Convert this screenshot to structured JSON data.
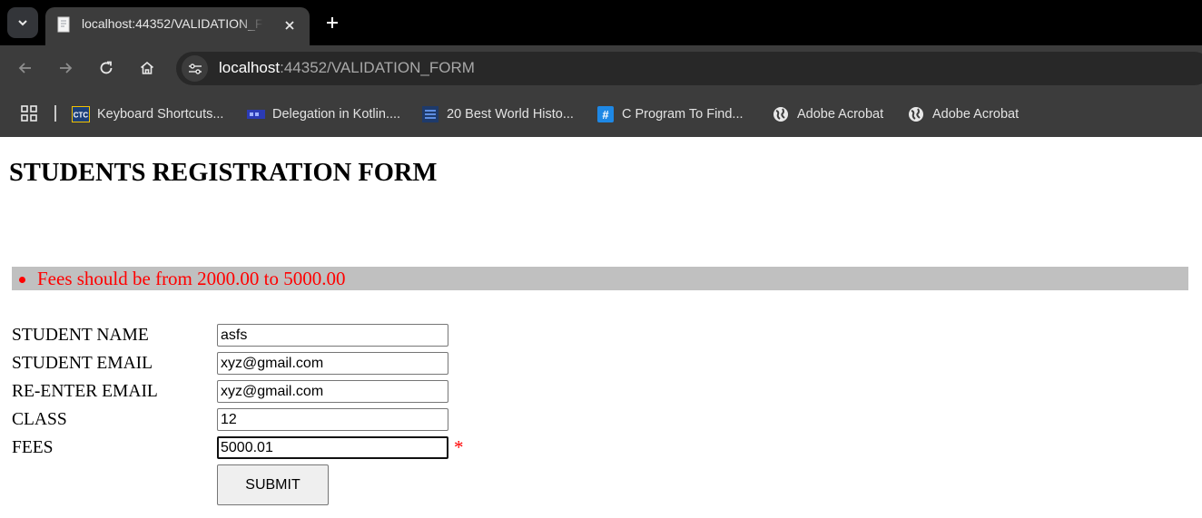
{
  "browser": {
    "tab": {
      "title": "localhost:44352/VALIDATION_FORM"
    },
    "address": {
      "host": "localhost",
      "rest": ":44352/VALIDATION_FORM"
    },
    "bookmarks": [
      {
        "label": "Keyboard Shortcuts...",
        "icon": "ctc-icon"
      },
      {
        "label": "Delegation in Kotlin....",
        "icon": "site-icon"
      },
      {
        "label": "20 Best World Histo...",
        "icon": "list-icon"
      },
      {
        "label": "C Program To Find...",
        "icon": "hash-icon"
      },
      {
        "label": "Adobe Acrobat",
        "icon": "globe-icon"
      },
      {
        "label": "Adobe Acrobat",
        "icon": "globe-icon"
      }
    ]
  },
  "page": {
    "title": "STUDENTS REGISTRATION FORM",
    "validation_summary": [
      "Fees should be from 2000.00 to 5000.00"
    ],
    "form": {
      "fields": [
        {
          "label": "STUDENT NAME",
          "value": "asfs"
        },
        {
          "label": "STUDENT EMAIL",
          "value": "xyz@gmail.com"
        },
        {
          "label": "RE-ENTER EMAIL",
          "value": "xyz@gmail.com"
        },
        {
          "label": "CLASS",
          "value": "12"
        },
        {
          "label": "FEES",
          "value": "5000.01"
        }
      ],
      "fees_error_marker": "*",
      "submit_label": "SUBMIT"
    }
  },
  "colors": {
    "error": "#ff0000",
    "summary_background": "#c0c0c0",
    "chrome_dark": "#3c3c3c"
  }
}
